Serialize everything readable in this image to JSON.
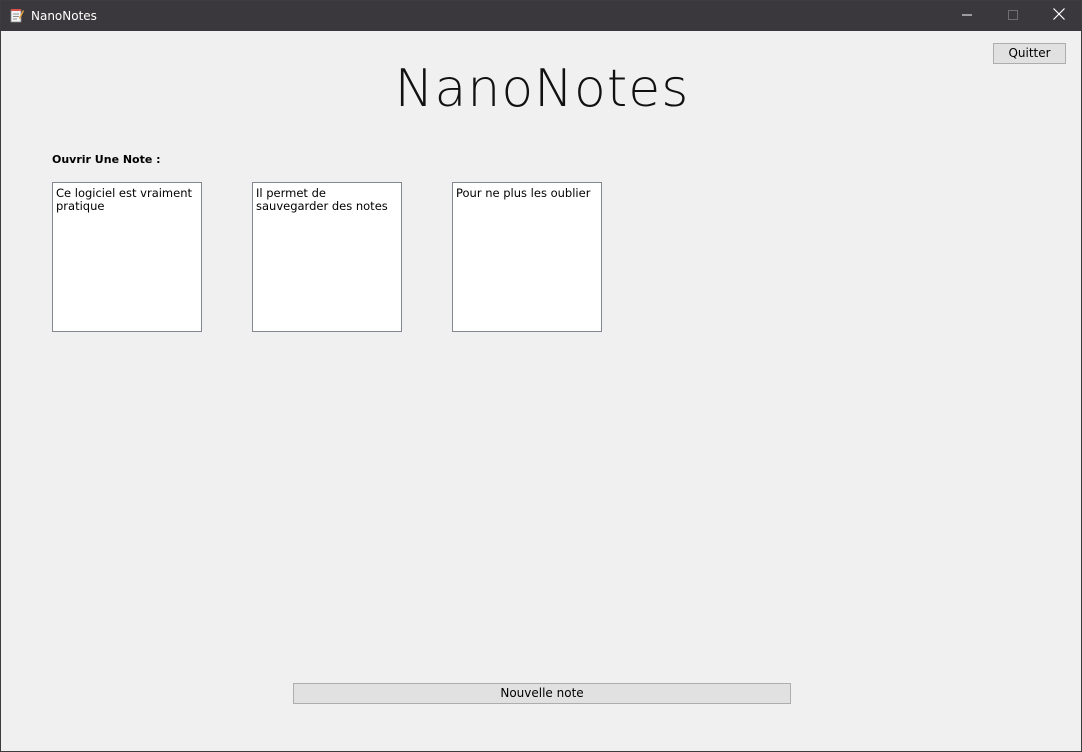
{
  "window": {
    "title": "NanoNotes",
    "icon": "notepad-icon",
    "controls": [
      "minimize-icon",
      "maximize-icon",
      "close-icon"
    ]
  },
  "header": {
    "quit_label": "Quitter",
    "app_title": "NanoNotes"
  },
  "notes_section": {
    "label": "Ouvrir Une Note :",
    "notes": [
      {
        "text": "Ce logiciel est vraiment pratique"
      },
      {
        "text": "Il permet de sauvegarder des notes"
      },
      {
        "text": "Pour ne plus les oublier"
      }
    ]
  },
  "footer": {
    "new_note_label": "Nouvelle note"
  },
  "colors": {
    "titlebar": "#3a383c",
    "background": "#f0f0f0",
    "button": "#e1e1e1",
    "note_background": "#ffffff"
  }
}
